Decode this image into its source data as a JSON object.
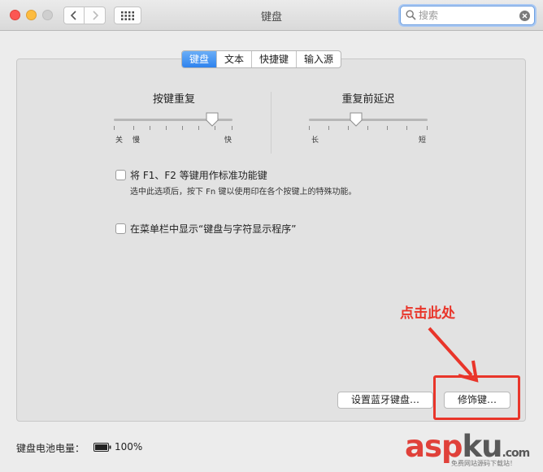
{
  "window": {
    "title": "键盘"
  },
  "search": {
    "placeholder": "搜索"
  },
  "tabs": [
    {
      "label": "键盘",
      "active": true
    },
    {
      "label": "文本",
      "active": false
    },
    {
      "label": "快捷键",
      "active": false
    },
    {
      "label": "输入源",
      "active": false
    }
  ],
  "key_repeat": {
    "title": "按键重复",
    "labels": {
      "off": "关",
      "slow": "慢",
      "fast": "快"
    },
    "value_fraction": 0.83
  },
  "delay_until_repeat": {
    "title": "重复前延迟",
    "labels": {
      "long": "长",
      "short": "短"
    },
    "value_fraction": 0.4
  },
  "fn_keys": {
    "label": "将 F1、F2 等键用作标准功能键",
    "description": "选中此选项后，按下 Fn 键以使用印在各个按键上的特殊功能。",
    "checked": false
  },
  "menu_bar_viewer": {
    "label": "在菜单栏中显示“键盘与字符显示程序”",
    "checked": false
  },
  "buttons": {
    "bluetooth": "设置蓝牙键盘…",
    "modifier": "修饰键…"
  },
  "annotation": {
    "text": "点击此处",
    "color": "#e9352a"
  },
  "battery": {
    "label": "键盘电池电量：",
    "percent": "100%"
  },
  "watermark": {
    "brand_a": "asp",
    "brand_b": "ku",
    "suffix": ".com",
    "sub": "免费网站源码下载站！"
  },
  "colors": {
    "accent": "#2e83ee",
    "annotation": "#e9352a"
  }
}
